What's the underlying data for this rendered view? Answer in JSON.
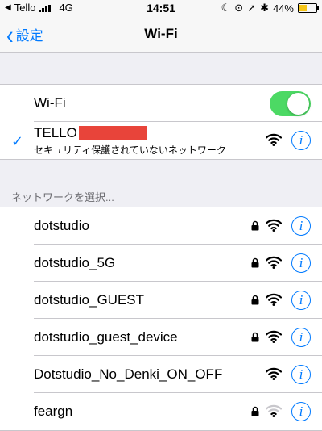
{
  "status_bar": {
    "carrier": "Tello",
    "network": "4G",
    "time": "14:51",
    "battery": "44%"
  },
  "nav": {
    "back_label": "設定",
    "title": "Wi-Fi"
  },
  "wifi_toggle": {
    "label": "Wi-Fi",
    "on": true
  },
  "connected": {
    "name": "TELLO",
    "subtitle": "セキュリティ保護されていないネットワーク"
  },
  "section_header": "ネットワークを選択...",
  "networks": [
    {
      "name": "dotstudio",
      "locked": true,
      "signal": "full"
    },
    {
      "name": "dotstudio_5G",
      "locked": true,
      "signal": "full"
    },
    {
      "name": "dotstudio_GUEST",
      "locked": true,
      "signal": "full"
    },
    {
      "name": "dotstudio_guest_device",
      "locked": true,
      "signal": "full"
    },
    {
      "name": "Dotstudio_No_Denki_ON_OFF",
      "locked": false,
      "signal": "full"
    },
    {
      "name": "feargn",
      "locked": true,
      "signal": "weak"
    }
  ],
  "colors": {
    "accent": "#007aff",
    "toggle_on": "#4cd964",
    "redaction": "#e8443a"
  }
}
